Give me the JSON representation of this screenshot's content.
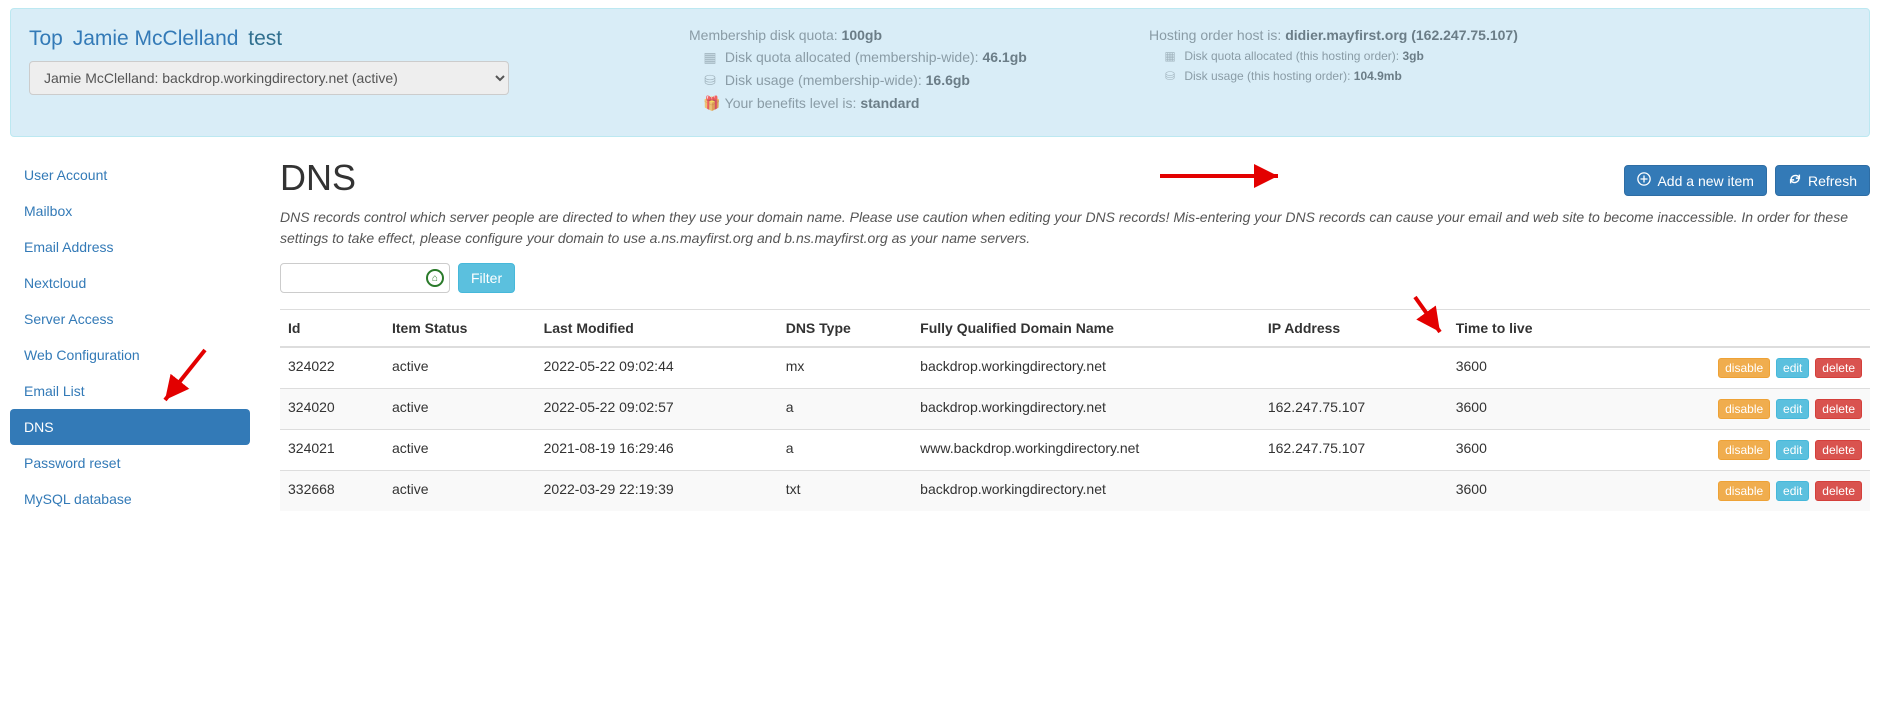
{
  "breadcrumb": {
    "top": "Top",
    "user": "Jamie McClelland",
    "current": "test"
  },
  "hosting_select": "Jamie McClelland: backdrop.workingdirectory.net (active)",
  "quota": {
    "membership_label": "Membership disk quota:",
    "membership_value": "100gb",
    "allocated_label": "Disk quota allocated (membership-wide):",
    "allocated_value": "46.1gb",
    "usage_label": "Disk usage (membership-wide):",
    "usage_value": "16.6gb",
    "benefits_label": "Your benefits level is:",
    "benefits_value": "standard"
  },
  "hosting": {
    "host_label": "Hosting order host is:",
    "host_value": "didier.mayfirst.org (162.247.75.107)",
    "allocated_label": "Disk quota allocated (this hosting order):",
    "allocated_value": "3gb",
    "usage_label": "Disk usage (this hosting order):",
    "usage_value": "104.9mb"
  },
  "sidebar": {
    "items": [
      {
        "label": "User Account"
      },
      {
        "label": "Mailbox"
      },
      {
        "label": "Email Address"
      },
      {
        "label": "Nextcloud"
      },
      {
        "label": "Server Access"
      },
      {
        "label": "Web Configuration"
      },
      {
        "label": "Email List"
      },
      {
        "label": "DNS"
      },
      {
        "label": "Password reset"
      },
      {
        "label": "MySQL database"
      }
    ],
    "active_index": 7
  },
  "page": {
    "title": "DNS",
    "description": "DNS records control which server people are directed to when they use your domain name. Please use caution when editing your DNS records! Mis-entering your DNS records can cause your email and web site to become inaccessible. In order for these settings to take effect, please configure your domain to use a.ns.mayfirst.org and b.ns.mayfirst.org as your name servers."
  },
  "actions": {
    "add": "Add a new item",
    "refresh": "Refresh",
    "filter": "Filter"
  },
  "row_actions": {
    "disable": "disable",
    "edit": "edit",
    "delete": "delete"
  },
  "table": {
    "headers": [
      "Id",
      "Item Status",
      "Last Modified",
      "DNS Type",
      "Fully Qualified Domain Name",
      "IP Address",
      "Time to live",
      ""
    ],
    "rows": [
      {
        "id": "324022",
        "status": "active",
        "modified": "2022-05-22 09:02:44",
        "type": "mx",
        "fqdn": "backdrop.workingdirectory.net",
        "ip": "",
        "ttl": "3600"
      },
      {
        "id": "324020",
        "status": "active",
        "modified": "2022-05-22 09:02:57",
        "type": "a",
        "fqdn": "backdrop.workingdirectory.net",
        "ip": "162.247.75.107",
        "ttl": "3600"
      },
      {
        "id": "324021",
        "status": "active",
        "modified": "2021-08-19 16:29:46",
        "type": "a",
        "fqdn": "www.backdrop.workingdirectory.net",
        "ip": "162.247.75.107",
        "ttl": "3600"
      },
      {
        "id": "332668",
        "status": "active",
        "modified": "2022-03-29 22:19:39",
        "type": "txt",
        "fqdn": "backdrop.workingdirectory.net",
        "ip": "",
        "ttl": "3600"
      }
    ]
  }
}
